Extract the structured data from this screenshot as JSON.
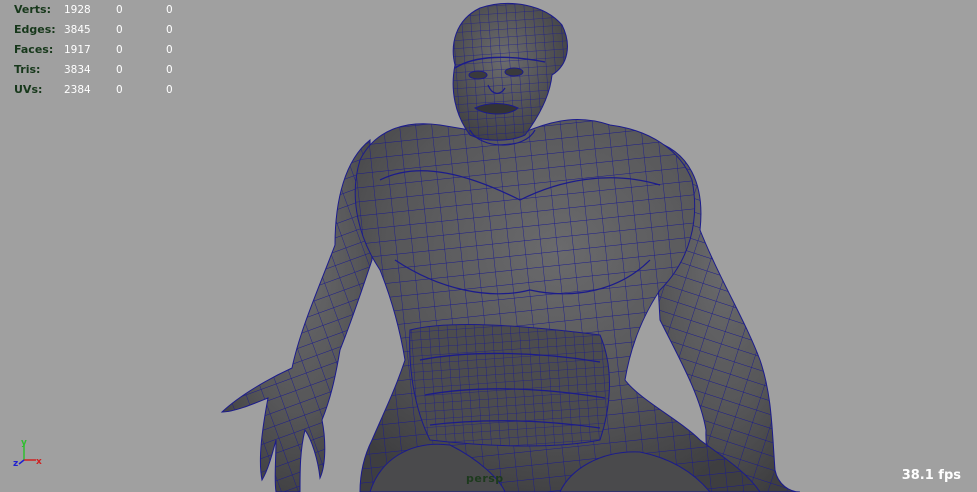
{
  "hud": {
    "rows": [
      {
        "label": "Verts:",
        "a": "1928",
        "b": "0",
        "c": "0"
      },
      {
        "label": "Edges:",
        "a": "3845",
        "b": "0",
        "c": "0"
      },
      {
        "label": "Faces:",
        "a": "1917",
        "b": "0",
        "c": "0"
      },
      {
        "label": "Tris:",
        "a": "3834",
        "b": "0",
        "c": "0"
      },
      {
        "label": "UVs:",
        "a": "2384",
        "b": "0",
        "c": "0"
      }
    ]
  },
  "axis": {
    "y": "y",
    "z": "z",
    "x": "x"
  },
  "camera": {
    "name": "persp"
  },
  "fps": {
    "text": "38.1 fps"
  },
  "colors": {
    "background": "#a0a0a0",
    "mesh_fill": "#5a5a5c",
    "wireframe": "#1b1b8c",
    "hud_label": "#17381b",
    "hud_value": "#ffffff"
  }
}
